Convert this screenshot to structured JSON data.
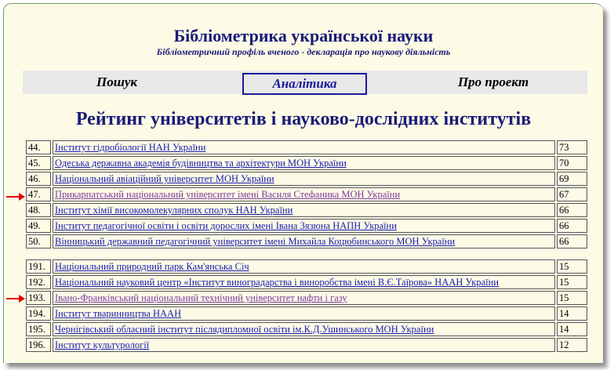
{
  "header": {
    "title": "Бібліометрика української науки",
    "subtitle": "Бібліометричний профіль вченого - декларація про наукову діяльність"
  },
  "nav": {
    "items": [
      {
        "label": "Пошук",
        "active": false
      },
      {
        "label": "Аналітика",
        "active": true
      },
      {
        "label": "Про проект",
        "active": false
      }
    ]
  },
  "section_title": "Рейтинг університетів і науково-дослідних інститутів",
  "table1": {
    "rows": [
      {
        "rank": "44.",
        "name": "Інститут гідробіології НАН України",
        "score": "73",
        "highlighted": false
      },
      {
        "rank": "45.",
        "name": "Одеська державна академія будівництва та архітектури МОН України",
        "score": "70",
        "highlighted": false
      },
      {
        "rank": "46.",
        "name": "Національний авіаційний університет МОН України",
        "score": "69",
        "highlighted": false
      },
      {
        "rank": "47.",
        "name": "Прикарпатський національний університет імені Василя Стефаника МОН України",
        "score": "67",
        "highlighted": true
      },
      {
        "rank": "48.",
        "name": "Інститут хімії високомолекулярних сполук НАН України",
        "score": "66",
        "highlighted": false
      },
      {
        "rank": "49.",
        "name": "Інститут педагогічної освіти і освіти дорослих імені Івана Зязюна НАПН України",
        "score": "66",
        "highlighted": false
      },
      {
        "rank": "50.",
        "name": "Вінницький державний педагогічний університет імені Михайла Коцюбинського МОН України",
        "score": "66",
        "highlighted": false
      }
    ]
  },
  "table2": {
    "rows": [
      {
        "rank": "191.",
        "name": "Національний природний парк Кам'янська Січ",
        "score": "15",
        "highlighted": false
      },
      {
        "rank": "192.",
        "name": "Національний науковий центр «Інститут виноградарства і виноробства імені В.Є.Таїрова» НААН України",
        "score": "15",
        "highlighted": false
      },
      {
        "rank": "193.",
        "name": "Івано-Франківський національний технічний університет нафти і газу",
        "score": "15",
        "highlighted": true
      },
      {
        "rank": "194.",
        "name": "Інститут тваринництва НААН",
        "score": "14",
        "highlighted": false
      },
      {
        "rank": "195.",
        "name": "Чернігівський обласний інститут післядипломної освіти ім.К.Д.Ушинського МОН України",
        "score": "14",
        "highlighted": false
      },
      {
        "rank": "196.",
        "name": "Інститут культурології",
        "score": "12",
        "highlighted": false
      }
    ]
  },
  "colors": {
    "background": "#fdfbe6",
    "heading": "#1a1a7a",
    "link": "#1a1ab0",
    "visited_link": "#7a3aa0",
    "arrow": "#e00000"
  }
}
